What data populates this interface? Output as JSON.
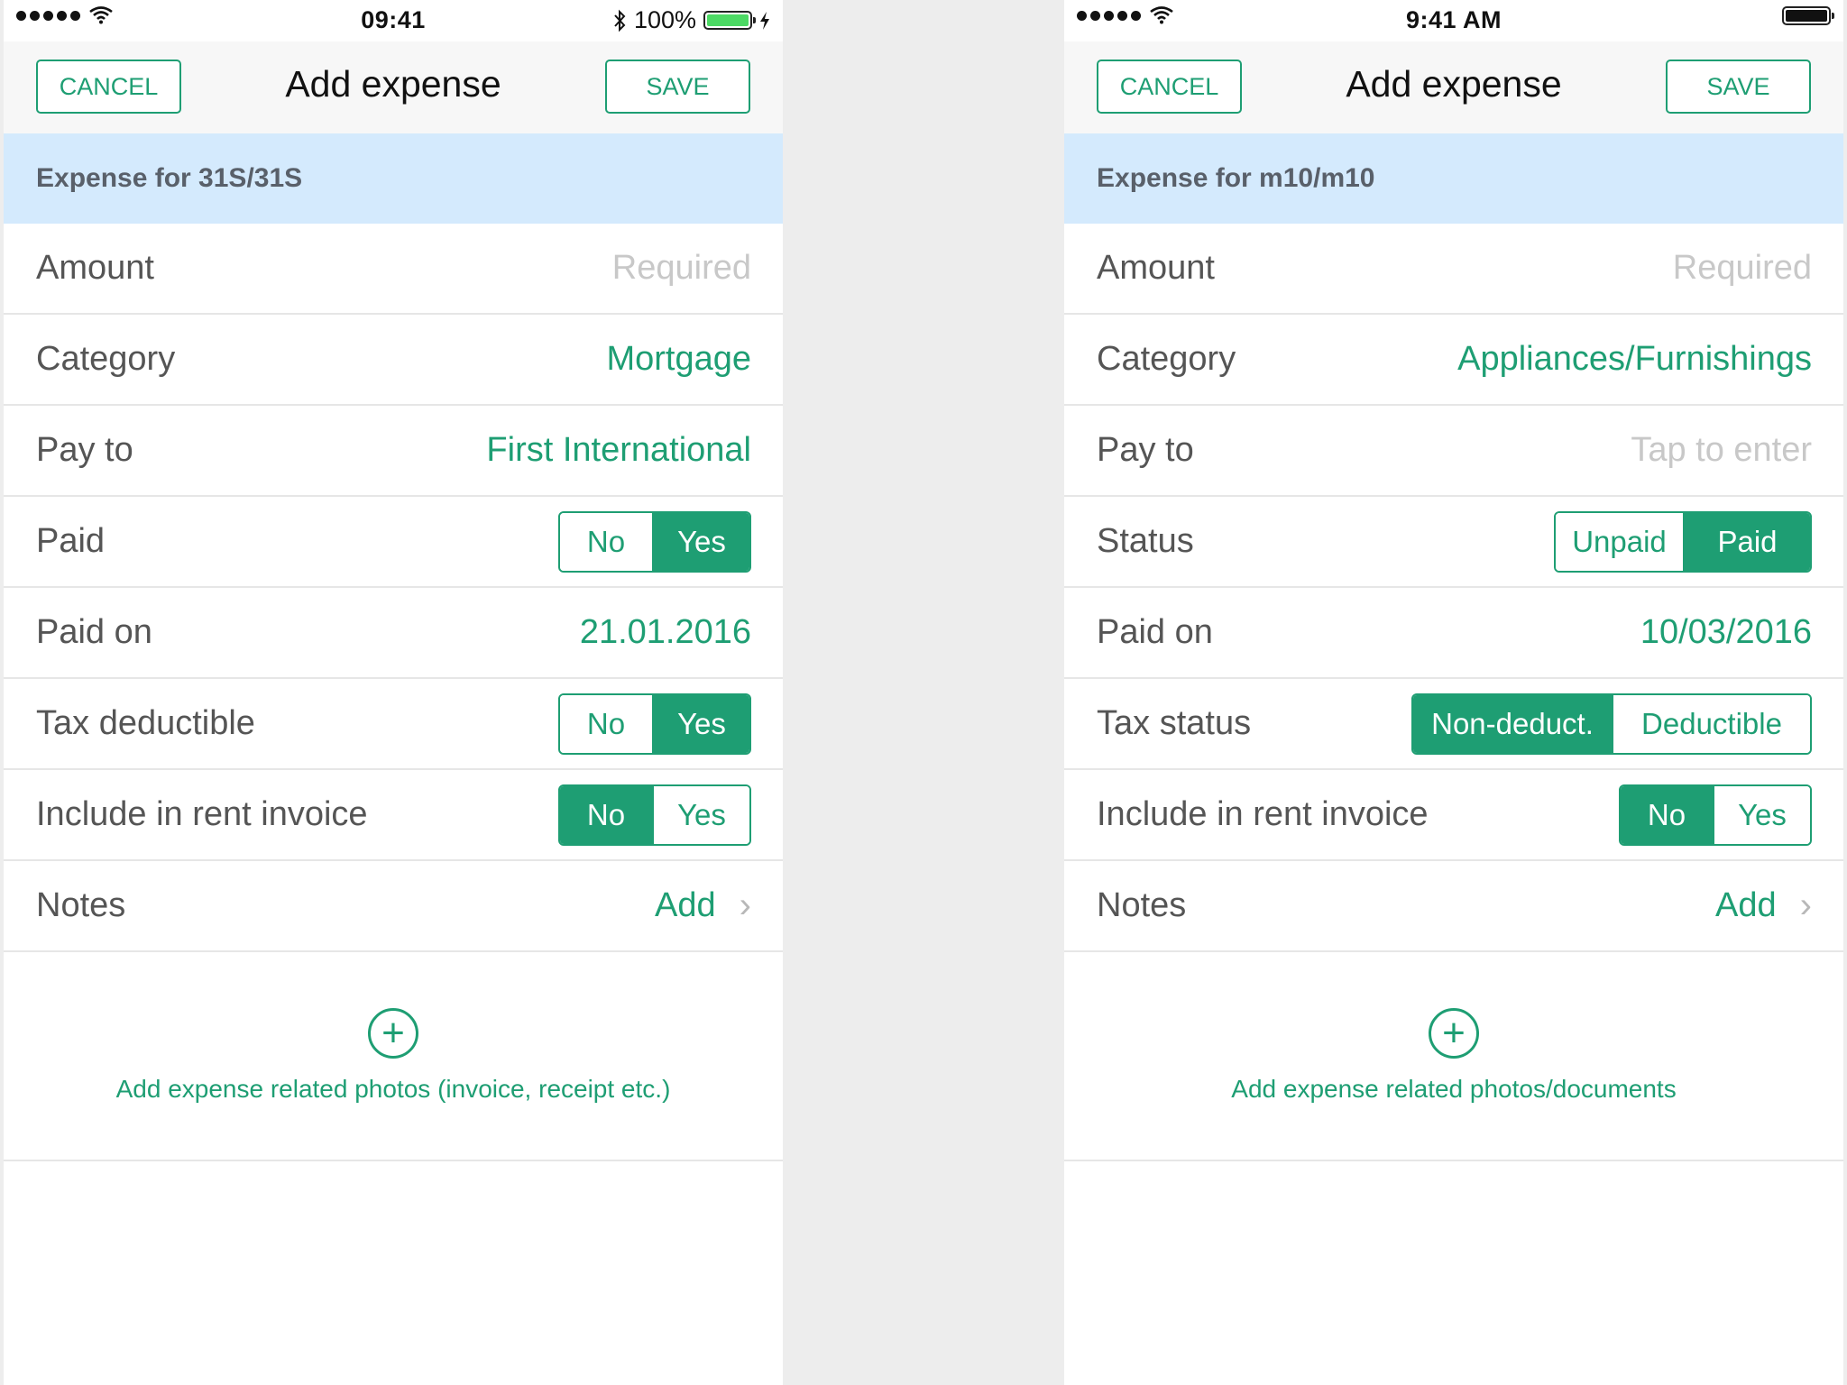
{
  "colors": {
    "accent": "#1e9e73",
    "banner": "#d4eafd",
    "placeholder": "#c8c8c8",
    "battery": "#4cd964"
  },
  "left": {
    "status": {
      "time": "09:41",
      "battery": "100%"
    },
    "nav": {
      "cancel": "CANCEL",
      "title": "Add expense",
      "save": "SAVE"
    },
    "banner": "Expense for 31S/31S",
    "rows": {
      "amount": {
        "label": "Amount",
        "value": "Required"
      },
      "category": {
        "label": "Category",
        "value": "Mortgage"
      },
      "payto": {
        "label": "Pay to",
        "value": "First International"
      },
      "paid": {
        "label": "Paid",
        "opt1": "No",
        "opt2": "Yes",
        "selected": "Yes"
      },
      "paidon": {
        "label": "Paid on",
        "value": "21.01.2016"
      },
      "tax": {
        "label": "Tax deductible",
        "opt1": "No",
        "opt2": "Yes",
        "selected": "Yes"
      },
      "rent": {
        "label": "Include in rent invoice",
        "opt1": "No",
        "opt2": "Yes",
        "selected": "No"
      },
      "notes": {
        "label": "Notes",
        "value": "Add"
      }
    },
    "photos": "Add expense related photos (invoice, receipt etc.)"
  },
  "right": {
    "status": {
      "time": "9:41 AM"
    },
    "nav": {
      "cancel": "CANCEL",
      "title": "Add expense",
      "save": "SAVE"
    },
    "banner": "Expense for m10/m10",
    "rows": {
      "amount": {
        "label": "Amount",
        "value": "Required"
      },
      "category": {
        "label": "Category",
        "value": "Appliances/Furnishings"
      },
      "payto": {
        "label": "Pay to",
        "value": "Tap to enter"
      },
      "status": {
        "label": "Status",
        "opt1": "Unpaid",
        "opt2": "Paid",
        "selected": "Paid"
      },
      "paidon": {
        "label": "Paid on",
        "value": "10/03/2016"
      },
      "tax": {
        "label": "Tax status",
        "opt1": "Non-deduct.",
        "opt2": "Deductible",
        "selected": "Non-deduct."
      },
      "rent": {
        "label": "Include in rent invoice",
        "opt1": "No",
        "opt2": "Yes",
        "selected": "No"
      },
      "notes": {
        "label": "Notes",
        "value": "Add"
      }
    },
    "photos": "Add expense related photos/documents"
  }
}
